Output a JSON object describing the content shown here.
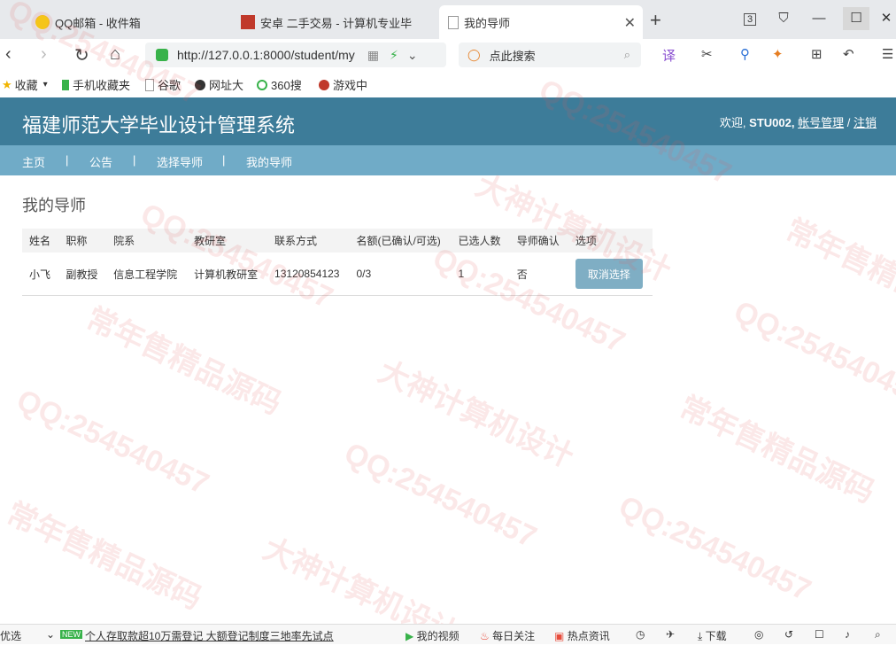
{
  "browser": {
    "tabs": [
      {
        "label": "QQ邮箱 - 收件箱"
      },
      {
        "label": "安卓 二手交易 - 计算机专业毕"
      },
      {
        "label": "我的导师"
      }
    ],
    "tab_count": "3",
    "url": "http://127.0.0.1:8000/student/my",
    "search_placeholder": "点此搜索",
    "bookmarks": [
      "收藏",
      "手机收藏夹",
      "谷歌",
      "网址大",
      "360搜",
      "游戏中"
    ]
  },
  "site": {
    "title": "福建师范大学毕业设计管理系统",
    "welcome": "欢迎,",
    "username": "STU002,",
    "account_link": "帐号管理",
    "slash": "/",
    "logout_link": "注销",
    "nav": [
      "主页",
      "公告",
      "选择导师",
      "我的导师"
    ],
    "nav_sep": "|"
  },
  "main": {
    "heading": "我的导师",
    "table": {
      "headers": [
        "姓名",
        "职称",
        "院系",
        "教研室",
        "联系方式",
        "名额(已确认/可选)",
        "已选人数",
        "导师确认",
        "选项"
      ],
      "rows": [
        {
          "name": "小飞",
          "title": "副教授",
          "dept": "信息工程学院",
          "office": "计算机教研室",
          "contact": "13120854123",
          "quota": "0/3",
          "selected": "1",
          "confirmed": "否",
          "action": "取消选择"
        }
      ]
    }
  },
  "statusbar": {
    "left": "优选",
    "news_badge": "NEW",
    "news": "个人存取款超10万需登记 大额登记制度三地率先试点",
    "items": [
      "我的视频",
      "每日关注",
      "热点资讯",
      "下载"
    ]
  },
  "watermark": {
    "texts": [
      "QQ:254540457",
      "大神计算机设计",
      "常年售精品源码"
    ]
  },
  "colors": {
    "header": "#3d7c99",
    "nav": "#70abc7",
    "button": "#7faec4"
  }
}
